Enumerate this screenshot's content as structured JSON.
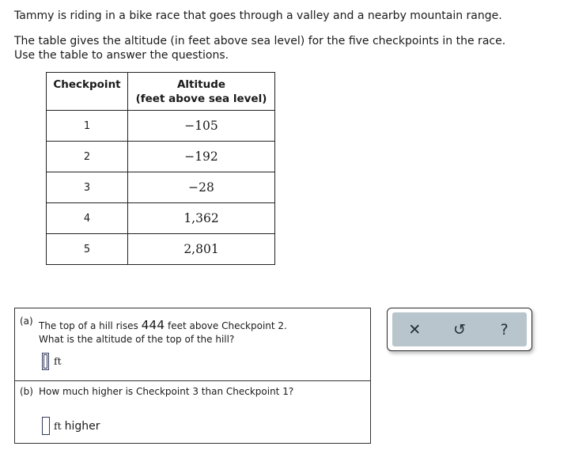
{
  "intro": {
    "line1": "Tammy is riding in a bike race that goes through a valley and a nearby mountain range.",
    "line2": "The table gives the altitude (in feet above sea level) for the five checkpoints in the race.",
    "line3": "Use the table to answer the questions."
  },
  "table": {
    "headers": [
      "Checkpoint",
      "Altitude",
      "(feet above sea level)"
    ],
    "rows": [
      {
        "checkpoint": "1",
        "altitude": "−105"
      },
      {
        "checkpoint": "2",
        "altitude": "−192"
      },
      {
        "checkpoint": "3",
        "altitude": "−28"
      },
      {
        "checkpoint": "4",
        "altitude": "1,362"
      },
      {
        "checkpoint": "5",
        "altitude": "2,801"
      }
    ]
  },
  "questions": {
    "a": {
      "label": "(a)",
      "text_pre": "The top of a hill rises ",
      "number": "444",
      "text_post": " feet above Checkpoint 2.",
      "line2": "What is the altitude of the top of the hill?",
      "answer_value": "",
      "unit": "ft"
    },
    "b": {
      "label": "(b)",
      "text": "How much higher is Checkpoint 3 than Checkpoint 1?",
      "answer_value": "",
      "unit": "ft",
      "unit_suffix": "higher"
    }
  },
  "toolbar": {
    "clear_icon": "✕",
    "undo_icon": "↺",
    "help_icon": "?"
  }
}
